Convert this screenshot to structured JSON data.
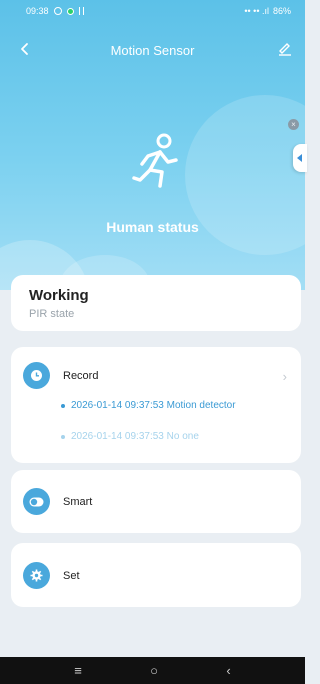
{
  "status_bar": {
    "time": "09:38",
    "right_text": "•• •• .ıl",
    "battery": "86%"
  },
  "app_bar": {
    "title": "Motion Sensor",
    "back_icon": "chevron-left-icon",
    "edit_icon": "edit-pen-icon"
  },
  "hero": {
    "figure_icon": "walking-person-icon",
    "label": "Human status"
  },
  "state_card": {
    "value": "Working",
    "caption": "PIR state"
  },
  "record_card": {
    "label": "Record",
    "icon": "clock-icon",
    "entries": [
      "2026-01-14 09:37:53 Motion detector",
      "2026-01-14 09:37:53 No one"
    ]
  },
  "smart_card": {
    "label": "Smart",
    "icon": "toggle-icon"
  },
  "set_card": {
    "label": "Set",
    "icon": "gear-icon"
  },
  "nav_bar": {
    "menu": "≡",
    "home": "○",
    "back": "‹"
  },
  "colors": {
    "hero_top": "#5cc1e8",
    "accent": "#4aa8dc",
    "record_active": "#3a9ad4",
    "record_inactive": "#a6d3ec"
  }
}
